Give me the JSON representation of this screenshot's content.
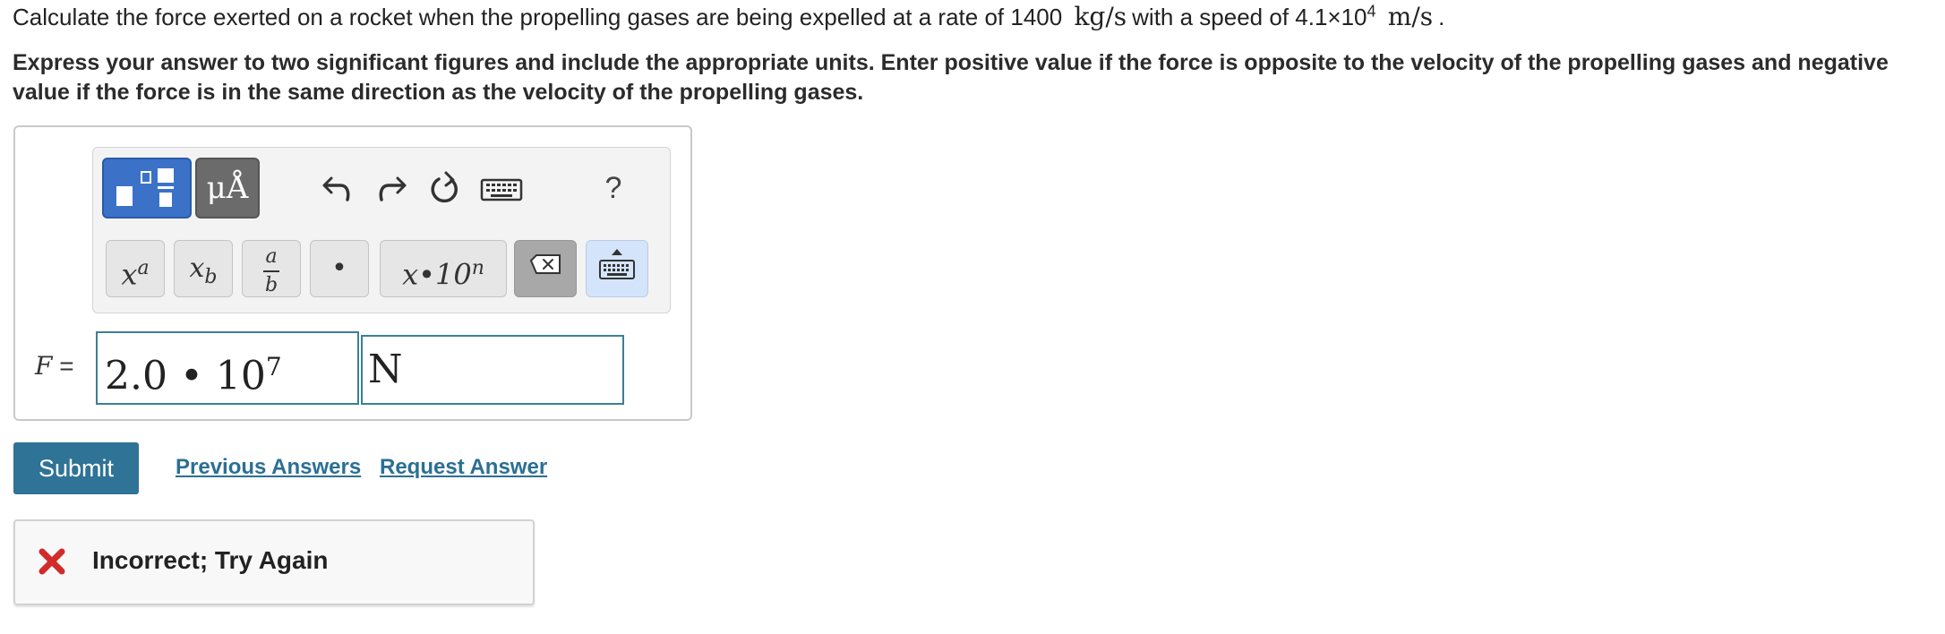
{
  "question": {
    "text_1": "Calculate the force exerted on a rocket when the propelling gases are being expelled at a rate of 1400",
    "rate_unit": "kg/s",
    "text_2": "with a speed of 4.1×10",
    "speed_exponent": "4",
    "speed_unit": "m/s",
    "text_3": "."
  },
  "instructions": "Express your answer to two significant figures and include the appropriate units. Enter positive value if the force is opposite to the velocity of the propelling gases and negative value if the force is in the same direction as the velocity of the propelling gases.",
  "toolbar": {
    "units_label": "μÅ",
    "help_label": "?",
    "keys": {
      "sup_base": "x",
      "sup_exp": "a",
      "sub_base": "x",
      "sub_index": "b",
      "frac_num": "a",
      "frac_den": "b",
      "dot": "•",
      "sci_label": "x•10",
      "sci_exp": "n"
    }
  },
  "answer": {
    "variable": "F",
    "equals": "=",
    "value_mantissa": "2.0 • 10",
    "value_exponent": "7",
    "unit": "N"
  },
  "actions": {
    "submit_label": "Submit",
    "previous_answers_label": "Previous Answers",
    "request_answer_label": "Request Answer"
  },
  "feedback": {
    "message": "Incorrect; Try Again"
  },
  "colors": {
    "accent": "#2f7396",
    "field_border": "#3c7f95",
    "error": "#d22b2b",
    "template_button": "#3b72c8"
  }
}
